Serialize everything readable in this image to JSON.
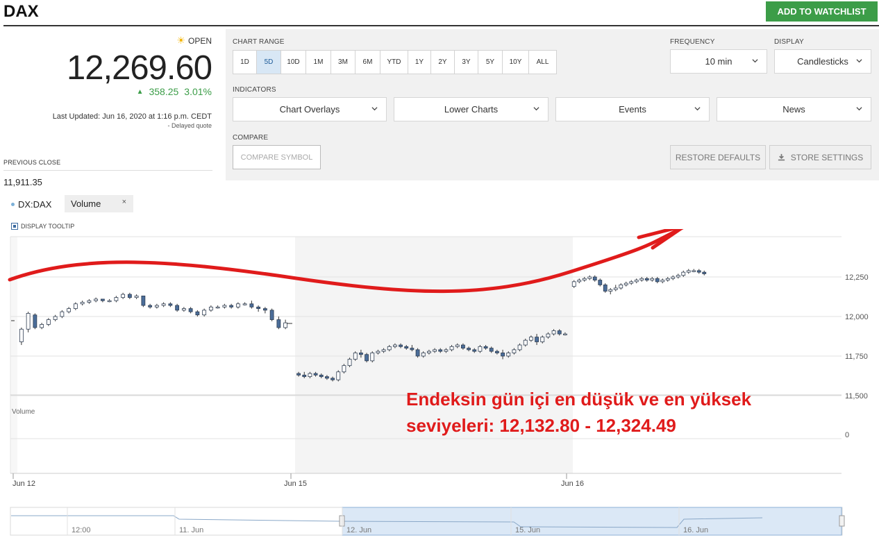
{
  "header": {
    "ticker": "DAX",
    "watchlist_label": "ADD TO WATCHLIST"
  },
  "quote": {
    "status": "OPEN",
    "price": "12,269.60",
    "change": "358.25",
    "change_pct": "3.01%",
    "last_updated": "Last Updated: Jun 16, 2020 at 1:16 p.m. CEDT",
    "delayed": "-  Delayed quote",
    "previous_close_label": "PREVIOUS CLOSE",
    "previous_close": "11,911.35",
    "colors": {
      "up": "#3c9d48",
      "sun": "#f4b400"
    }
  },
  "controls": {
    "chart_range_label": "CHART RANGE",
    "ranges": [
      "1D",
      "5D",
      "10D",
      "1M",
      "3M",
      "6M",
      "YTD",
      "1Y",
      "2Y",
      "3Y",
      "5Y",
      "10Y",
      "ALL"
    ],
    "active_range": "5D",
    "frequency_label": "FREQUENCY",
    "frequency_value": "10 min",
    "display_label": "DISPLAY",
    "display_value": "Candlesticks",
    "indicators_label": "INDICATORS",
    "chart_overlays": "Chart Overlays",
    "lower_charts": "Lower Charts",
    "events": "Events",
    "news": "News",
    "compare_label": "COMPARE",
    "compare_placeholder": "COMPARE SYMBOL",
    "restore_defaults": "RESTORE DEFAULTS",
    "store_settings": "STORE SETTINGS",
    "icons": {
      "dropdown": "chevron-down-icon",
      "store": "download-icon",
      "status": "sun-icon"
    }
  },
  "chart_header": {
    "symbol": "DX:DAX",
    "volume_tag": "Volume",
    "volume_close": "×",
    "display_tooltip": "DISPLAY TOOLTIP",
    "volume_pane_label": "Volume"
  },
  "chart_data": {
    "type": "candlestick",
    "x_labels": [
      "Jun 12",
      "Jun 15",
      "Jun 16"
    ],
    "y_ticks": [
      12250,
      12000,
      11750,
      11500
    ],
    "y_tick_labels": [
      "12,250",
      "12,000",
      "11,750",
      "11,500"
    ],
    "volume_ticks": [
      "0"
    ],
    "ylim": [
      11450,
      12330
    ],
    "sessions": [
      {
        "label": "Jun 12",
        "candles": [
          [
            11840,
            11930,
            11820,
            11920
          ],
          [
            11920,
            12030,
            11900,
            12020
          ],
          [
            12010,
            12020,
            11920,
            11930
          ],
          [
            11930,
            11960,
            11920,
            11950
          ],
          [
            11950,
            11990,
            11940,
            11980
          ],
          [
            11980,
            12010,
            11970,
            12000
          ],
          [
            12000,
            12040,
            11990,
            12030
          ],
          [
            12030,
            12060,
            12020,
            12050
          ],
          [
            12050,
            12090,
            12040,
            12080
          ],
          [
            12080,
            12100,
            12070,
            12090
          ],
          [
            12090,
            12110,
            12080,
            12100
          ],
          [
            12100,
            12120,
            12090,
            12110
          ],
          [
            12110,
            12110,
            12090,
            12100
          ],
          [
            12100,
            12110,
            12090,
            12100
          ],
          [
            12100,
            12130,
            12090,
            12120
          ],
          [
            12120,
            12150,
            12110,
            12140
          ],
          [
            12140,
            12150,
            12110,
            12120
          ],
          [
            12120,
            12140,
            12110,
            12130
          ],
          [
            12130,
            12130,
            12060,
            12070
          ],
          [
            12070,
            12080,
            12050,
            12060
          ],
          [
            12060,
            12080,
            12050,
            12070
          ],
          [
            12070,
            12090,
            12060,
            12080
          ],
          [
            12080,
            12090,
            12060,
            12070
          ],
          [
            12070,
            12080,
            12030,
            12040
          ],
          [
            12040,
            12060,
            12030,
            12050
          ],
          [
            12050,
            12060,
            12020,
            12030
          ],
          [
            12030,
            12040,
            12000,
            12010
          ],
          [
            12010,
            12050,
            12000,
            12040
          ],
          [
            12040,
            12070,
            12030,
            12060
          ],
          [
            12060,
            12070,
            12050,
            12060
          ],
          [
            12060,
            12080,
            12050,
            12070
          ],
          [
            12070,
            12080,
            12050,
            12060
          ],
          [
            12060,
            12090,
            12050,
            12080
          ],
          [
            12080,
            12090,
            12070,
            12080
          ],
          [
            12080,
            12100,
            12050,
            12060
          ],
          [
            12060,
            12070,
            12030,
            12050
          ],
          [
            12050,
            12060,
            12020,
            12040
          ],
          [
            12040,
            12050,
            11970,
            11980
          ],
          [
            11980,
            12000,
            11920,
            11930
          ],
          [
            11930,
            11980,
            11920,
            11960
          ]
        ]
      },
      {
        "label": "Jun 15",
        "candles": [
          [
            11640,
            11650,
            11620,
            11630
          ],
          [
            11630,
            11650,
            11610,
            11620
          ],
          [
            11620,
            11650,
            11610,
            11640
          ],
          [
            11640,
            11650,
            11620,
            11630
          ],
          [
            11630,
            11640,
            11610,
            11620
          ],
          [
            11620,
            11630,
            11600,
            11610
          ],
          [
            11610,
            11620,
            11590,
            11600
          ],
          [
            11600,
            11660,
            11590,
            11650
          ],
          [
            11650,
            11700,
            11640,
            11690
          ],
          [
            11690,
            11740,
            11680,
            11730
          ],
          [
            11730,
            11780,
            11720,
            11770
          ],
          [
            11770,
            11790,
            11740,
            11760
          ],
          [
            11760,
            11770,
            11710,
            11720
          ],
          [
            11720,
            11780,
            11710,
            11770
          ],
          [
            11770,
            11790,
            11760,
            11780
          ],
          [
            11780,
            11800,
            11770,
            11790
          ],
          [
            11790,
            11820,
            11780,
            11810
          ],
          [
            11810,
            11830,
            11800,
            11820
          ],
          [
            11820,
            11830,
            11800,
            11810
          ],
          [
            11810,
            11820,
            11790,
            11800
          ],
          [
            11800,
            11820,
            11780,
            11790
          ],
          [
            11790,
            11800,
            11740,
            11750
          ],
          [
            11750,
            11780,
            11740,
            11770
          ],
          [
            11770,
            11790,
            11760,
            11780
          ],
          [
            11780,
            11800,
            11770,
            11790
          ],
          [
            11790,
            11800,
            11770,
            11780
          ],
          [
            11780,
            11800,
            11770,
            11790
          ],
          [
            11790,
            11820,
            11780,
            11810
          ],
          [
            11810,
            11830,
            11800,
            11820
          ],
          [
            11820,
            11830,
            11790,
            11800
          ],
          [
            11800,
            11810,
            11780,
            11790
          ],
          [
            11790,
            11800,
            11770,
            11780
          ],
          [
            11780,
            11820,
            11770,
            11810
          ],
          [
            11810,
            11820,
            11790,
            11800
          ],
          [
            11800,
            11810,
            11770,
            11780
          ],
          [
            11780,
            11790,
            11760,
            11770
          ],
          [
            11770,
            11790,
            11730,
            11750
          ],
          [
            11750,
            11780,
            11740,
            11770
          ],
          [
            11770,
            11800,
            11760,
            11790
          ],
          [
            11790,
            11830,
            11780,
            11820
          ],
          [
            11820,
            11860,
            11810,
            11850
          ],
          [
            11850,
            11880,
            11840,
            11870
          ],
          [
            11870,
            11890,
            11820,
            11840
          ],
          [
            11840,
            11880,
            11830,
            11870
          ],
          [
            11870,
            11900,
            11860,
            11890
          ],
          [
            11890,
            11920,
            11880,
            11910
          ],
          [
            11910,
            11920,
            11880,
            11890
          ],
          [
            11890,
            11900,
            11880,
            11890
          ]
        ]
      },
      {
        "label": "Jun 16",
        "candles": [
          [
            12190,
            12230,
            12180,
            12220
          ],
          [
            12220,
            12240,
            12210,
            12230
          ],
          [
            12230,
            12250,
            12220,
            12240
          ],
          [
            12240,
            12260,
            12230,
            12250
          ],
          [
            12250,
            12260,
            12220,
            12230
          ],
          [
            12230,
            12240,
            12190,
            12200
          ],
          [
            12200,
            12210,
            12150,
            12160
          ],
          [
            12160,
            12180,
            12140,
            12170
          ],
          [
            12170,
            12200,
            12160,
            12180
          ],
          [
            12180,
            12210,
            12170,
            12200
          ],
          [
            12200,
            12220,
            12190,
            12210
          ],
          [
            12210,
            12230,
            12200,
            12220
          ],
          [
            12220,
            12240,
            12210,
            12230
          ],
          [
            12230,
            12250,
            12220,
            12240
          ],
          [
            12240,
            12250,
            12220,
            12230
          ],
          [
            12230,
            12250,
            12220,
            12240
          ],
          [
            12240,
            12250,
            12210,
            12220
          ],
          [
            12220,
            12240,
            12210,
            12230
          ],
          [
            12230,
            12250,
            12220,
            12240
          ],
          [
            12240,
            12260,
            12230,
            12250
          ],
          [
            12250,
            12270,
            12240,
            12260
          ],
          [
            12260,
            12290,
            12250,
            12280
          ],
          [
            12280,
            12300,
            12270,
            12290
          ],
          [
            12290,
            12300,
            12280,
            12290
          ],
          [
            12290,
            12300,
            12270,
            12280
          ],
          [
            12280,
            12290,
            12260,
            12270
          ]
        ]
      }
    ],
    "navigator": {
      "labels": [
        "12:00",
        "11. Jun",
        "12. Jun",
        "15. Jun",
        "16. Jun"
      ]
    }
  },
  "annotation": {
    "line1": "Endeksin gün içi en düşük ve en yüksek",
    "line2": "seviyeleri: 12,132.80 - 12,324.49",
    "color": "#e01b1b"
  }
}
